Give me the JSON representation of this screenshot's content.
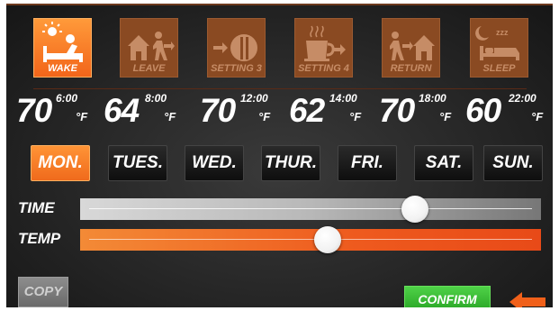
{
  "periods": [
    {
      "label": "WAKE",
      "icon": "wake-icon",
      "active": true
    },
    {
      "label": "LEAVE",
      "icon": "leave-icon",
      "active": false
    },
    {
      "label": "SETTING 3",
      "icon": "meal-icon",
      "active": false
    },
    {
      "label": "SETTING 4",
      "icon": "coffee-icon",
      "active": false
    },
    {
      "label": "RETURN",
      "icon": "return-icon",
      "active": false
    },
    {
      "label": "SLEEP",
      "icon": "sleep-icon",
      "active": false
    }
  ],
  "temps": [
    {
      "value": "70",
      "time": "6:00",
      "unit": "°F"
    },
    {
      "value": "64",
      "time": "8:00",
      "unit": "°F"
    },
    {
      "value": "70",
      "time": "12:00",
      "unit": "°F"
    },
    {
      "value": "62",
      "time": "14:00",
      "unit": "°F"
    },
    {
      "value": "70",
      "time": "18:00",
      "unit": "°F"
    },
    {
      "value": "60",
      "time": "22:00",
      "unit": "°F"
    }
  ],
  "days": [
    {
      "label": "MON.",
      "active": true
    },
    {
      "label": "TUES.",
      "active": false
    },
    {
      "label": "WED.",
      "active": false
    },
    {
      "label": "THUR.",
      "active": false
    },
    {
      "label": "FRI.",
      "active": false
    },
    {
      "label": "SAT.",
      "active": false
    },
    {
      "label": "SUN.",
      "active": false
    }
  ],
  "sliders": {
    "time": {
      "label": "TIME",
      "level": 0.74
    },
    "temp": {
      "label": "TEMP",
      "level": 0.54
    }
  },
  "buttons": {
    "copy": "COPY",
    "confirm": "CONFIRM"
  },
  "colors": {
    "accent": "#f26b1d",
    "confirm": "#35b82e",
    "tile_inactive": "#8a4a22"
  }
}
